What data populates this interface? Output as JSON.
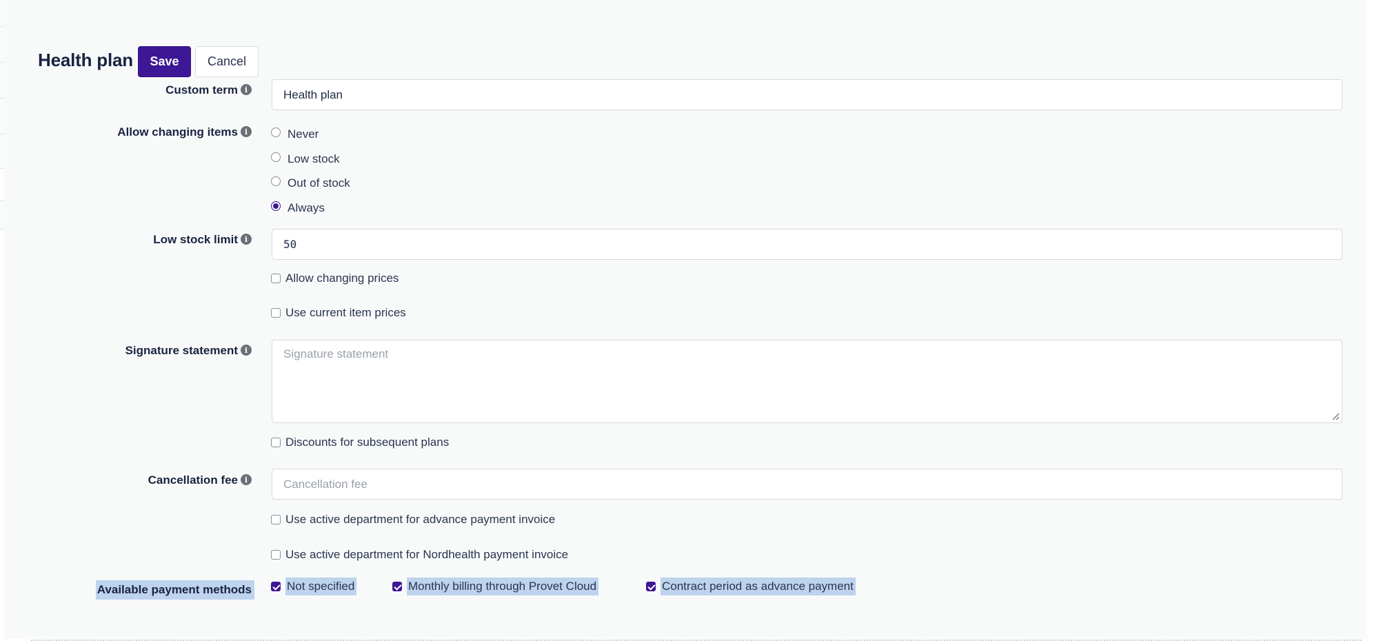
{
  "header": {
    "title": "Health plan",
    "save_label": "Save",
    "cancel_label": "Cancel"
  },
  "form": {
    "custom_term": {
      "label": "Custom term",
      "value": "Health plan",
      "info_icon": "info-icon"
    },
    "allow_changing_items": {
      "label": "Allow changing items",
      "info_icon": "info-icon",
      "options": [
        {
          "label": "Never",
          "selected": false
        },
        {
          "label": "Low stock",
          "selected": false
        },
        {
          "label": "Out of stock",
          "selected": false
        },
        {
          "label": "Always",
          "selected": true
        }
      ]
    },
    "low_stock_limit": {
      "label": "Low stock limit",
      "value": "50",
      "info_icon": "info-icon"
    },
    "allow_changing_prices": {
      "label": "Allow changing prices",
      "checked": false
    },
    "use_current_item_prices": {
      "label": "Use current item prices",
      "checked": false
    },
    "signature_statement": {
      "label": "Signature statement",
      "value": "",
      "placeholder": "Signature statement",
      "info_icon": "info-icon"
    },
    "discounts_subsequent_plans": {
      "label": "Discounts for subsequent plans",
      "checked": false
    },
    "cancellation_fee": {
      "label": "Cancellation fee",
      "value": "",
      "placeholder": "Cancellation fee",
      "info_icon": "info-icon"
    },
    "use_active_dept_advance": {
      "label": "Use active department for advance payment invoice",
      "checked": false
    },
    "use_active_dept_nordhealth": {
      "label": "Use active department for Nordhealth payment invoice",
      "checked": false
    },
    "available_payment_methods": {
      "label": "Available payment methods",
      "options": [
        {
          "label": "Not specified",
          "checked": true
        },
        {
          "label": "Monthly billing through Provet Cloud",
          "checked": true
        },
        {
          "label": "Contract period as advance payment",
          "checked": true
        }
      ]
    }
  },
  "colors": {
    "primary": "#3d1795",
    "selection_highlight": "#bdd3ee",
    "panel_background": "#f8fafa",
    "info_icon": "#6b7078"
  }
}
